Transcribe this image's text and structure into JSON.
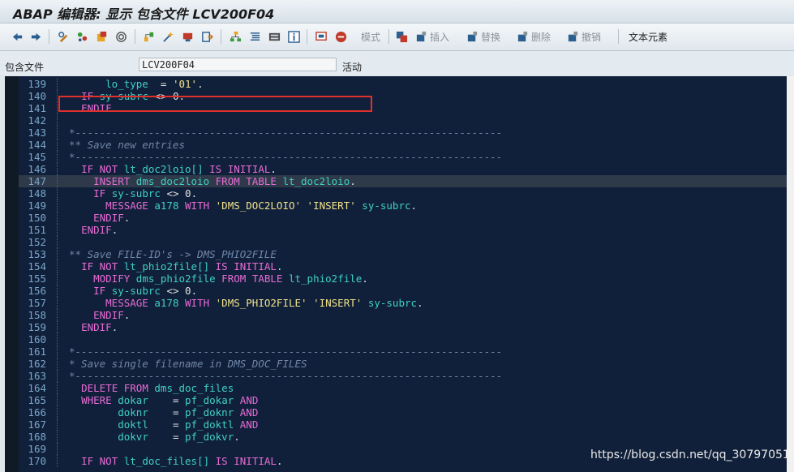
{
  "window": {
    "title": "ABAP 编辑器: 显示 包含文件 LCV200F04"
  },
  "toolbar": {
    "mode_label": "模式",
    "insert_label": "插入",
    "replace_label": "替换",
    "delete_label": "删除",
    "undo_label": "撤销",
    "text_elements_label": "文本元素",
    "icons": [
      "back-icon",
      "forward-icon",
      "display-change-icon",
      "other-object-icon",
      "activate-icon",
      "where-used-icon",
      "check-icon",
      "object-list-icon",
      "debug-icon",
      "navigate-icon",
      "pattern-icon",
      "pretty-printer-icon",
      "enhancement-icon",
      "info-icon",
      "find-icon",
      "stop-icon",
      "copy-icon",
      "insert-icon",
      "replace-icon",
      "delete-icon",
      "undo-icon"
    ]
  },
  "include_field": {
    "label": "包含文件",
    "value": "LCV200F04",
    "status": "活动"
  },
  "code": {
    "highlighted_line": "147",
    "lines": [
      {
        "n": "139",
        "t": "      lo_type  = '01'."
      },
      {
        "n": "140",
        "t": "  IF sy-subrc <> 0."
      },
      {
        "n": "141",
        "t": "  ENDIF."
      },
      {
        "n": "142",
        "t": ""
      },
      {
        "n": "143",
        "t": "*----------------------------------------------------------------------"
      },
      {
        "n": "144",
        "t": "** Save new entries"
      },
      {
        "n": "145",
        "t": "*----------------------------------------------------------------------"
      },
      {
        "n": "146",
        "t": "  IF NOT lt_doc2loio[] IS INITIAL."
      },
      {
        "n": "147",
        "t": "    INSERT dms_doc2loio FROM TABLE lt_doc2loio."
      },
      {
        "n": "148",
        "t": "    IF sy-subrc <> 0."
      },
      {
        "n": "149",
        "t": "      MESSAGE a178 WITH 'DMS_DOC2LOIO' 'INSERT' sy-subrc."
      },
      {
        "n": "150",
        "t": "    ENDIF."
      },
      {
        "n": "151",
        "t": "  ENDIF."
      },
      {
        "n": "152",
        "t": ""
      },
      {
        "n": "153",
        "t": "** Save FILE-ID's -> DMS_PHIO2FILE"
      },
      {
        "n": "154",
        "t": "  IF NOT lt_phio2file[] IS INITIAL."
      },
      {
        "n": "155",
        "t": "    MODIFY dms_phio2file FROM TABLE lt_phio2file."
      },
      {
        "n": "156",
        "t": "    IF sy-subrc <> 0."
      },
      {
        "n": "157",
        "t": "      MESSAGE a178 WITH 'DMS_PHIO2FILE' 'INSERT' sy-subrc."
      },
      {
        "n": "158",
        "t": "    ENDIF."
      },
      {
        "n": "159",
        "t": "  ENDIF."
      },
      {
        "n": "160",
        "t": ""
      },
      {
        "n": "161",
        "t": "*----------------------------------------------------------------------"
      },
      {
        "n": "162",
        "t": "* Save single filename in DMS_DOC_FILES"
      },
      {
        "n": "163",
        "t": "*----------------------------------------------------------------------"
      },
      {
        "n": "164",
        "t": "  DELETE FROM dms_doc_files"
      },
      {
        "n": "165",
        "t": "  WHERE dokar    = pf_dokar AND"
      },
      {
        "n": "166",
        "t": "        doknr    = pf_doknr AND"
      },
      {
        "n": "167",
        "t": "        doktl    = pf_doktl AND"
      },
      {
        "n": "168",
        "t": "        dokvr    = pf_dokvr."
      },
      {
        "n": "169",
        "t": ""
      },
      {
        "n": "170",
        "t": "  IF NOT lt_doc_files[] IS INITIAL."
      }
    ]
  },
  "watermark": "https://blog.csdn.net/qq_30797051",
  "colors": {
    "editor_bg": "#11203a",
    "keyword": "#e76bd5",
    "identifier": "#3fd0c3",
    "string": "#f0e38a",
    "comment": "#6f87a8",
    "highlight_box": "#e0302b"
  }
}
